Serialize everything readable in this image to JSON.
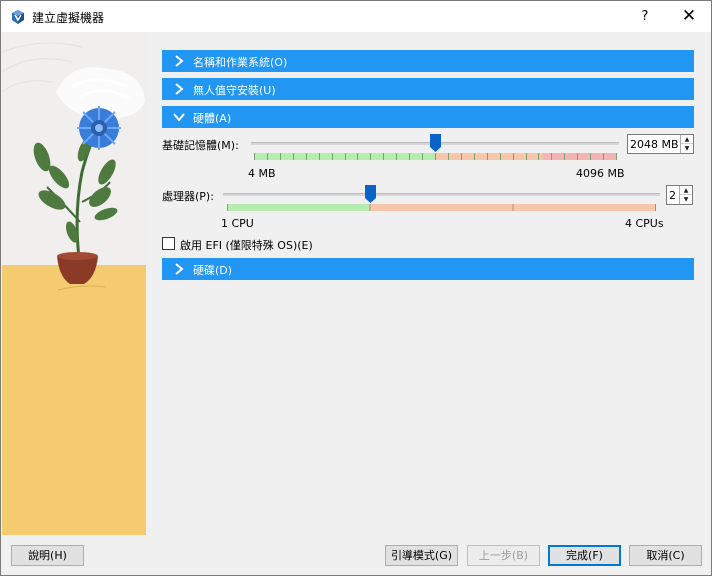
{
  "window": {
    "title": "建立虛擬機器",
    "help_label": "?",
    "close_label": "✕"
  },
  "sections": {
    "name_os": "名稱和作業系統(O)",
    "unattended": "無人值守安裝(U)",
    "hardware": "硬體(A)",
    "hard_disk": "硬碟(D)"
  },
  "memory": {
    "label": "基礎記憶體(M):",
    "value": "2048 MB",
    "min_label": "4 MB",
    "max_label": "4096 MB",
    "min_mb": 4,
    "max_mb": 4096,
    "current_mb": 2048
  },
  "processor": {
    "label": "處理器(P):",
    "value": "2",
    "min_label": "1 CPU",
    "max_label": "4 CPUs",
    "min": 1,
    "max": 4,
    "current": 2
  },
  "efi": {
    "label": "啟用 EFI (僅限特殊 OS)(E)",
    "checked": false
  },
  "buttons": {
    "help": "說明(H)",
    "guided": "引導模式(G)",
    "back": "上一步(B)",
    "finish": "完成(F)",
    "cancel": "取消(C)"
  },
  "colors": {
    "accent": "#2196f3",
    "scale_green": "#b5ecb0",
    "scale_orange": "#f7c6ab",
    "scale_red": "#f4b4b4",
    "thumb": "#0a64c8"
  }
}
